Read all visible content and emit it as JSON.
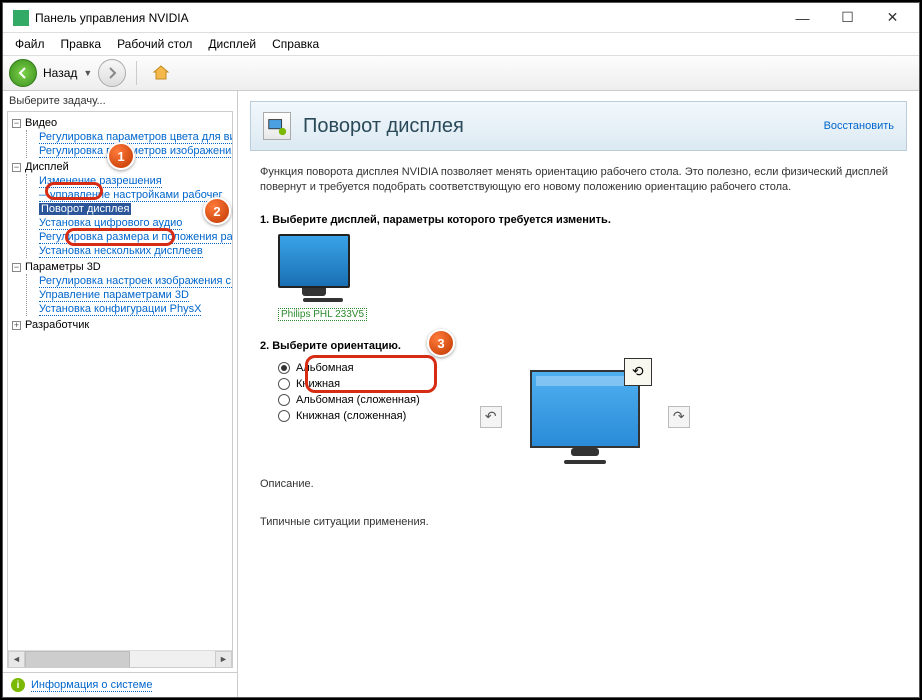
{
  "window": {
    "title": "Панель управления NVIDIA"
  },
  "menu": [
    "Файл",
    "Правка",
    "Рабочий стол",
    "Дисплей",
    "Справка"
  ],
  "nav": {
    "back": "Назад"
  },
  "sidebar": {
    "prompt": "Выберите задачу...",
    "groups": [
      {
        "label": "Видео",
        "items": [
          "Регулировка параметров цвета для вид",
          "Регулировка параметров изображения д"
        ]
      },
      {
        "label": "Дисплей",
        "items": [
          "Изменение разрешения",
          "—управление настройками рабочег",
          "Поворот дисплея",
          "Установка цифрового аудио",
          "Регулировка размера и положения рабо",
          "Установка нескольких дисплеев"
        ]
      },
      {
        "label": "Параметры 3D",
        "items": [
          "Регулировка настроек изображения с п",
          "Управление параметрами 3D",
          "Установка конфигурации PhysX"
        ]
      },
      {
        "label": "Разработчик",
        "items": []
      }
    ],
    "info_link": "Информация о системе"
  },
  "page": {
    "title": "Поворот дисплея",
    "restore": "Восстановить",
    "description": "Функция поворота дисплея NVIDIA позволяет менять ориентацию рабочего стола. Это полезно, если физический дисплей повернут и требуется подобрать соответствующую его новому положению ориентацию рабочего стола.",
    "step1": "1. Выберите дисплей, параметры которого требуется изменить.",
    "monitor_label": "Philips PHL 233V5",
    "step2": "2. Выберите ориентацию.",
    "orientations": [
      "Альбомная",
      "Книжная",
      "Альбомная (сложенная)",
      "Книжная (сложенная)"
    ],
    "desc_h": "Описание.",
    "typical_h": "Типичные ситуации применения."
  },
  "badges": {
    "b1": "1",
    "b2": "2",
    "b3": "3"
  }
}
